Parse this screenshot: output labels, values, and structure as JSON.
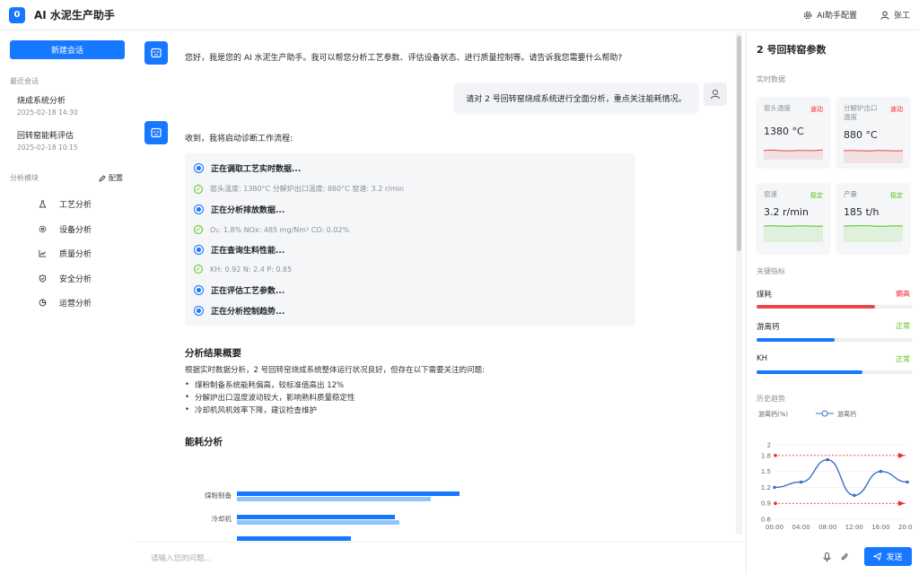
{
  "header": {
    "logo_glyph": "0",
    "title": "AI 水泥生产助手",
    "config_label": "AI助手配置",
    "user_name": "张工"
  },
  "sidebar": {
    "new_chat": "新建会话",
    "recent_label": "最近会话",
    "recent": [
      {
        "title": "烧成系统分析",
        "time": "2025-02-18 14:30"
      },
      {
        "title": "回转窑能耗评估",
        "time": "2025-02-18 10:15"
      }
    ],
    "modules_label": "分析模块",
    "modules_config": "配置",
    "modules": [
      {
        "label": "工艺分析",
        "icon": "flask-icon"
      },
      {
        "label": "设备分析",
        "icon": "gear-icon"
      },
      {
        "label": "质量分析",
        "icon": "line-chart-icon"
      },
      {
        "label": "安全分析",
        "icon": "shield-icon"
      },
      {
        "label": "运营分析",
        "icon": "pie-chart-icon"
      }
    ]
  },
  "chat": {
    "greeting": "您好，我是您的 AI 水泥生产助手。我可以帮您分析工艺参数、评估设备状态、进行质量控制等。请告诉我您需要什么帮助?",
    "user_msg": "请对 2 号回转窑烧成系统进行全面分析，重点关注能耗情况。",
    "reply_intro": "收到，我将启动诊断工作流程:",
    "workflow": [
      {
        "type": "step",
        "text": "正在调取工艺实时数据..."
      },
      {
        "type": "result",
        "text": "窑头温度: 1380°C 分解炉出口温度: 880°C 窑速: 3.2 r/min"
      },
      {
        "type": "step",
        "text": "正在分析排放数据..."
      },
      {
        "type": "result",
        "text": "O₂: 1.8% NOx: 485 mg/Nm³ CO: 0.02%"
      },
      {
        "type": "step",
        "text": "正在查询生料性能..."
      },
      {
        "type": "result",
        "text": "KH: 0.92 N: 2.4 P: 0.85"
      },
      {
        "type": "step",
        "text": "正在评估工艺参数..."
      },
      {
        "type": "step",
        "text": "正在分析控制趋势..."
      }
    ],
    "summary_title": "分析结果概要",
    "summary_intro": "根据实时数据分析，2 号回转窑烧成系统整体运行状况良好，但存在以下需要关注的问题:",
    "summary_items": [
      "煤粉制备系统能耗偏高，较标准值高出 12%",
      "分解炉出口温度波动较大，影响熟料质量稳定性",
      "冷却机风机效率下降，建议检查维护"
    ],
    "energy_title": "能耗分析",
    "energy_bars": [
      {
        "label": "煤粉制备",
        "current": 0.86,
        "standard": 0.75
      },
      {
        "label": "冷却机",
        "current": 0.61,
        "standard": 0.63
      },
      {
        "label": "",
        "current": 0.44,
        "standard": 0.0
      }
    ]
  },
  "input": {
    "placeholder": "请输入您的问题...",
    "send_label": "发送"
  },
  "panel": {
    "title": "2 号回转窑参数",
    "realtime_label": "实时数据",
    "cards": [
      {
        "name": "窑头温度",
        "value": "1380 °C",
        "tag": "波动",
        "tag_color": "#f5222d",
        "line_color": "#e8474b"
      },
      {
        "name": "分解炉出口温度",
        "value": "880 °C",
        "tag": "波动",
        "tag_color": "#f5222d",
        "line_color": "#e8474b"
      },
      {
        "name": "窑速",
        "value": "3.2 r/min",
        "tag": "稳定",
        "tag_color": "#52c41a",
        "line_color": "#52c41a"
      },
      {
        "name": "产量",
        "value": "185 t/h",
        "tag": "稳定",
        "tag_color": "#52c41a",
        "line_color": "#52c41a"
      }
    ],
    "kpi_label": "关键指标",
    "kpis": [
      {
        "name": "煤耗",
        "status": "偏高",
        "status_color": "#f5222d",
        "fill_color": "#e8474b",
        "level": 0.76
      },
      {
        "name": "游离钙",
        "status": "正常",
        "status_color": "#52c41a",
        "fill_color": "#1677ff",
        "level": 0.5
      },
      {
        "name": "KH",
        "status": "正常",
        "status_color": "#52c41a",
        "fill_color": "#1677ff",
        "level": 0.68
      }
    ],
    "trend_label": "历史趋势"
  },
  "chart_data": {
    "type": "line",
    "ylabel": "游离钙(%)",
    "x": [
      "00:00",
      "04:00",
      "08:00",
      "12:00",
      "16:00",
      "20:00"
    ],
    "series": [
      {
        "name": "游离钙",
        "x": [
          0,
          4,
          8,
          12,
          16,
          20
        ],
        "values": [
          1.2,
          1.3,
          1.72,
          1.05,
          1.5,
          1.3
        ]
      }
    ],
    "yticks": [
      0.6,
      0.9,
      1.2,
      1.5,
      1.8,
      2
    ],
    "ylim": [
      0.6,
      2
    ],
    "xlim": [
      0,
      20
    ],
    "ref_lines": [
      1.8,
      0.9
    ],
    "ref_color": "#f5222d",
    "line_color": "#3b6fc9",
    "legend": "top"
  }
}
